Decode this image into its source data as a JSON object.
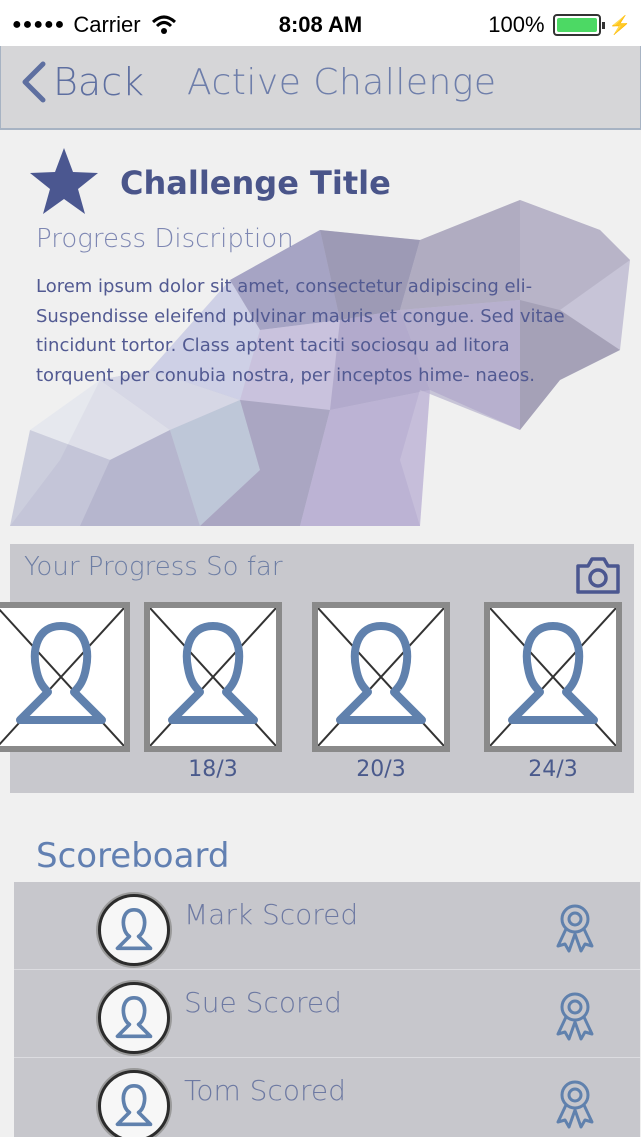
{
  "status_bar": {
    "carrier": "Carrier",
    "time": "8:08 AM",
    "battery": "100%"
  },
  "nav": {
    "back_label": "Back",
    "title": "Active Challenge"
  },
  "challenge": {
    "title": "Challenge Title",
    "subtitle": "Progress Discription",
    "body": "Lorem ipsum dolor sit amet, consectetur adipiscing eli- Suspendisse eleifend pulvinar mauris et congue. Sed vitae tincidunt tortor. Class aptent taciti sociosqu ad litora torquent per conubia nostra, per inceptos hime- naeos."
  },
  "progress": {
    "title": "Your Progress So far",
    "photos": [
      {
        "date": ""
      },
      {
        "date": "18/3"
      },
      {
        "date": "20/3"
      },
      {
        "date": "24/3"
      }
    ]
  },
  "scoreboard": {
    "title": "Scoreboard",
    "rows": [
      {
        "name": "Mark Scored"
      },
      {
        "name": "Sue Scored"
      },
      {
        "name": "Tom Scored"
      }
    ]
  },
  "colors": {
    "accent": "#4a558a",
    "nav_bg": "#d6d6d8",
    "panel_bg": "#c7c7cc",
    "icon_blue": "#6081ad"
  }
}
